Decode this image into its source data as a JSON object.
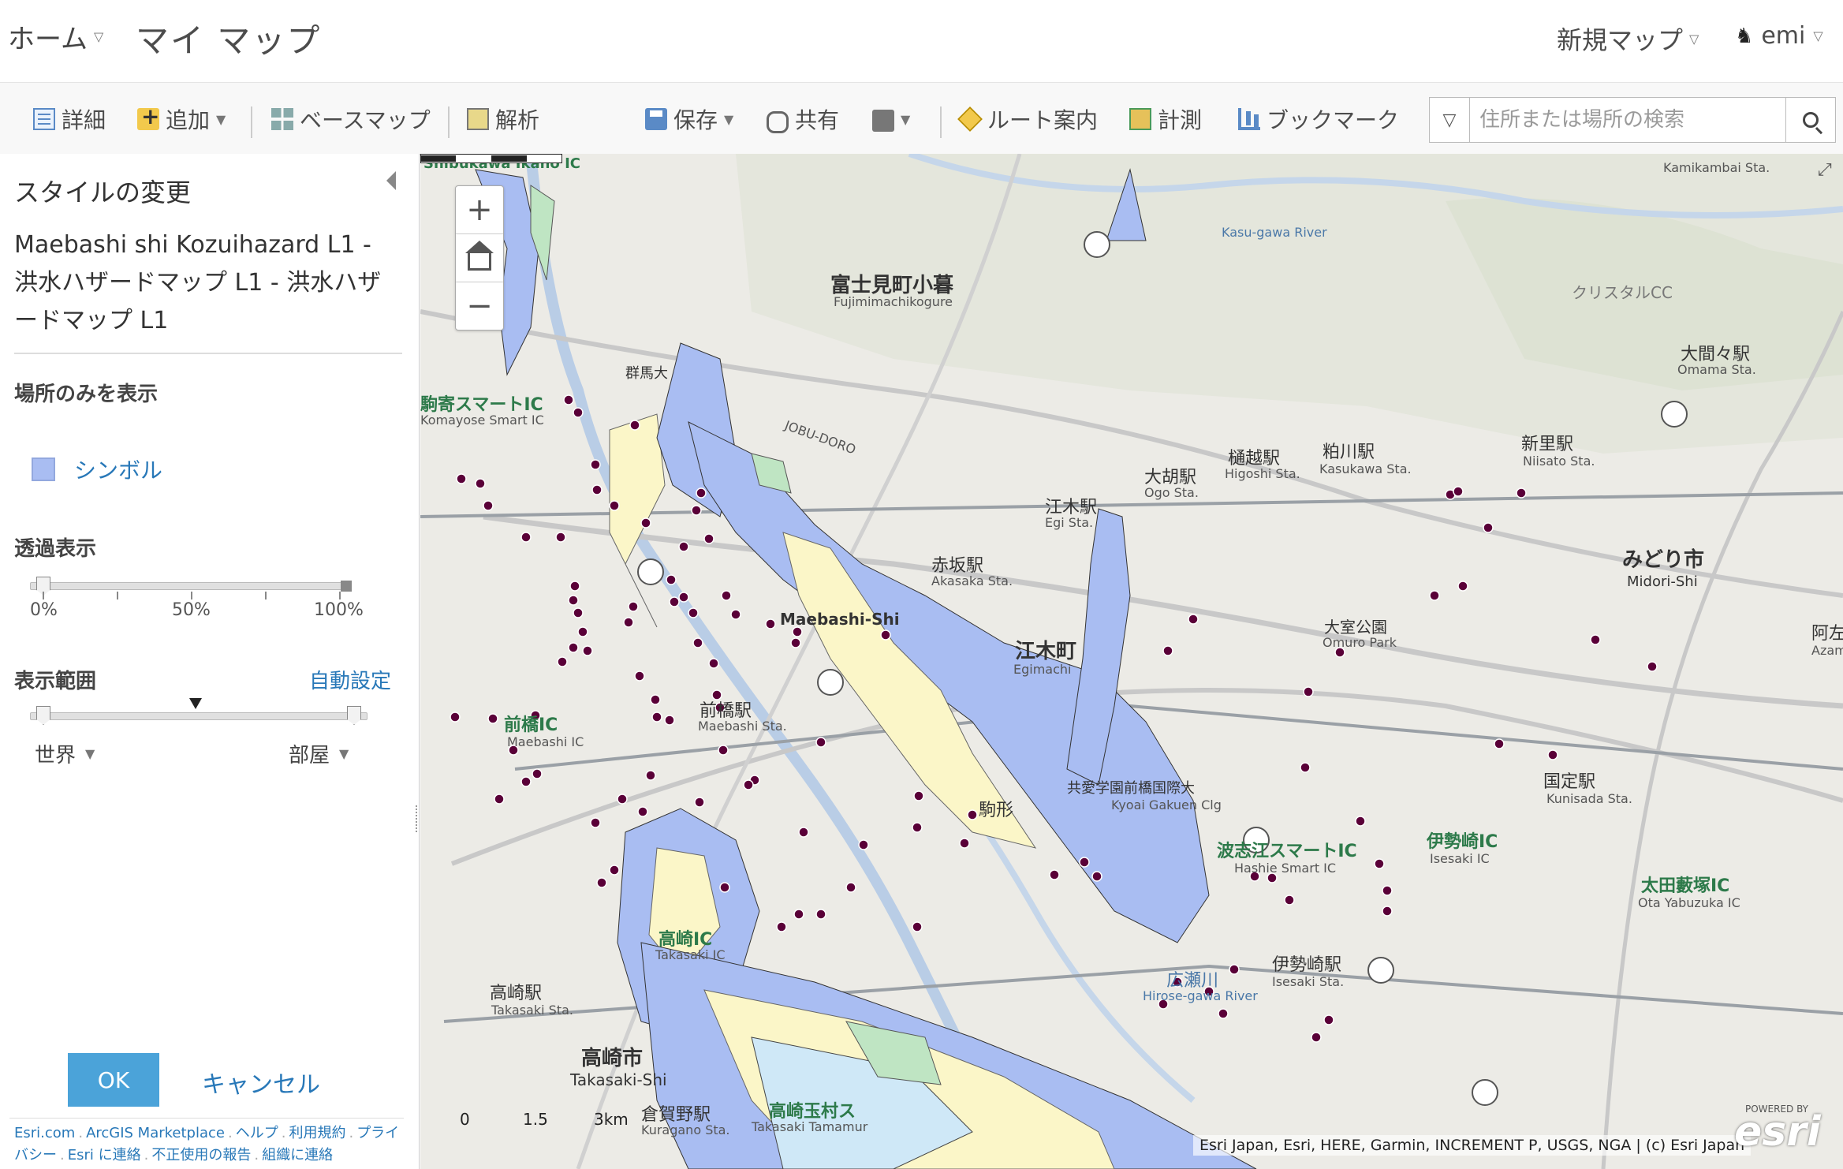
{
  "header": {
    "home_label": "ホーム",
    "title": "マイ マップ",
    "new_map_label": "新規マップ",
    "user_name": "emi"
  },
  "toolbar": {
    "details": "詳細",
    "add": "追加",
    "basemap": "ベースマップ",
    "analysis": "解析",
    "save": "保存",
    "share": "共有",
    "route": "ルート案内",
    "measure": "計測",
    "bookmark": "ブックマーク",
    "search_placeholder": "住所または場所の検索"
  },
  "panel": {
    "title": "スタイルの変更",
    "layer_name": "Maebashi shi Kozuihazard L1 - 洪水ハザードマップ L1 - 洪水ハザードマップ L1",
    "show_location_only": "場所のみを表示",
    "symbol_label": "シンボル",
    "symbol_color": "#a9bdf2",
    "transparency_label": "透過表示",
    "transparency_ticks": [
      "0%",
      "50%",
      "100%"
    ],
    "transparency_value": 0,
    "visible_range_label": "表示範囲",
    "auto_set_link": "自動設定",
    "range_min": "世界",
    "range_max": "部屋",
    "ok": "OK",
    "cancel": "キャンセル",
    "footer_links": [
      "Esri.com",
      "ArcGIS Marketplace",
      "ヘルプ",
      "利用規約",
      "プライバシー",
      "Esri に連絡",
      "不正使用の報告",
      "組織に連絡"
    ]
  },
  "map": {
    "attribution": "Esri Japan, Esri, HERE, Garmin, INCREMENT P, USGS, NGA | (c) Esri Japan",
    "scale_labels": [
      "0",
      "1.5",
      "3km"
    ],
    "logo": "esri",
    "logo_sub": "POWERED BY",
    "labels": {
      "shibukawa": "Shibukawa Ikaho IC",
      "fujimi": "富士見町小暮",
      "fujimi_en": "Fujimimachikogure",
      "kamikambai": "Kamikambai Sta.",
      "omama": "大間々駅",
      "omama_en": "Omama Sta.",
      "komayose": "駒寄スマートIC",
      "komayose_en": "Komayose Smart IC",
      "gunmadai": "群馬大",
      "ogo": "大胡駅",
      "ogo_en": "Ogo Sta.",
      "higoshi": "樋越駅",
      "higoshi_en": "Higoshi Sta.",
      "kasukawa": "粕川駅",
      "kasukawa_en": "Kasukawa Sta.",
      "niisato": "新里駅",
      "niisato_en": "Niisato Sta.",
      "egi": "江木駅",
      "egi_en": "Egi Sta.",
      "akasaka": "赤坂駅",
      "akasaka_en": "Akasaka Sta.",
      "midori": "みどり市",
      "midori_en": "Midori-Shi",
      "egimachi": "江木町",
      "egimachi_en": "Egimachi",
      "maebashi_shi": "Maebashi-Shi",
      "omuro": "大室公園",
      "omuro_en": "Omuro Park",
      "azami": "阿左美駅",
      "azami_en": "Azami St",
      "maebashi_ic": "前橋IC",
      "maebashi_ic_en": "Maebashi IC",
      "maebashi_sta": "前橋駅",
      "maebashi_sta_en": "Maebashi Sta.",
      "kunisada": "国定駅",
      "kunisada_en": "Kunisada Sta.",
      "hashie": "波志江スマートIC",
      "hashie_en": "Hashie Smart IC",
      "isesaki_ic": "伊勢崎IC",
      "isesaki_ic_en": "Isesaki IC",
      "otayabuzuka": "太田藪塚IC",
      "otayabuzuka_en": "Ota Yabuzuka IC",
      "takasaki_ic": "高崎IC",
      "takasaki_ic_en": "Takasaki IC",
      "takasaki_sta": "高崎駅",
      "takasaki_sta_en": "Takasaki Sta.",
      "takasaki_shi": "高崎市",
      "takasaki_shi_en": "Takasaki-Shi",
      "hirose": "広瀬川",
      "hirose_en": "Hirose-gawa River",
      "isesaki_sta": "伊勢崎駅",
      "isesaki_sta_en": "Isesaki Sta.",
      "kuragano": "倉賀野駅",
      "kuragano_en": "Kuragano Sta.",
      "takasaki_tamamura": "高崎玉村ス",
      "takasaki_tamamura_en": "Takasaki Tamamur",
      "kyoai": "共愛学園前橋国際大",
      "kyoai_en": "Kyoai Gakuen Clg",
      "komagata": "駒形",
      "kasugawa_river": "Kasu-gawa River",
      "christal": "クリスタルCC",
      "joburoad": "JOBU-DORO"
    }
  }
}
